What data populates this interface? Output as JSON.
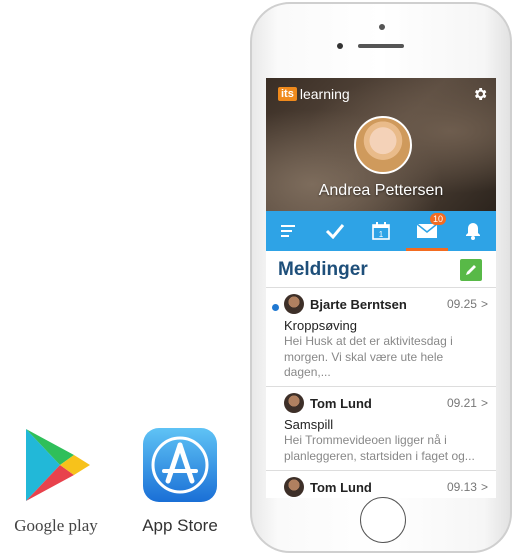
{
  "badges": {
    "google_play_label": "Google play",
    "app_store_label": "App Store"
  },
  "app": {
    "logo_prefix": "its",
    "logo_text": "learning",
    "user_name": "Andrea Pettersen",
    "accent_color": "#f36c21",
    "nav_color": "#2ea3e6"
  },
  "nav": {
    "calendar_day": "1",
    "messages_badge": "10"
  },
  "page": {
    "title": "Meldinger"
  },
  "messages": [
    {
      "sender": "Bjarte Berntsen",
      "time": "09.25",
      "subject": "Kroppsøving",
      "preview_line1": "Hei Husk at det er aktivitesdag i",
      "preview_line2": "morgen. Vi skal være ute hele dagen,...",
      "unread": true
    },
    {
      "sender": "Tom Lund",
      "time": "09.21",
      "subject": "Samspill",
      "preview_line1": "Hei Trommevideoen ligger nå i",
      "preview_line2": "planleggeren, startsiden i faget og...",
      "unread": false
    },
    {
      "sender": "Tom Lund",
      "time": "09.13",
      "unread": false
    }
  ],
  "icons": [
    "google-play-icon",
    "app-store-icon",
    "gear-icon",
    "menu-icon",
    "check-icon",
    "calendar-icon",
    "mail-icon",
    "bell-icon",
    "pencil-icon",
    "chevron-right-icon"
  ]
}
